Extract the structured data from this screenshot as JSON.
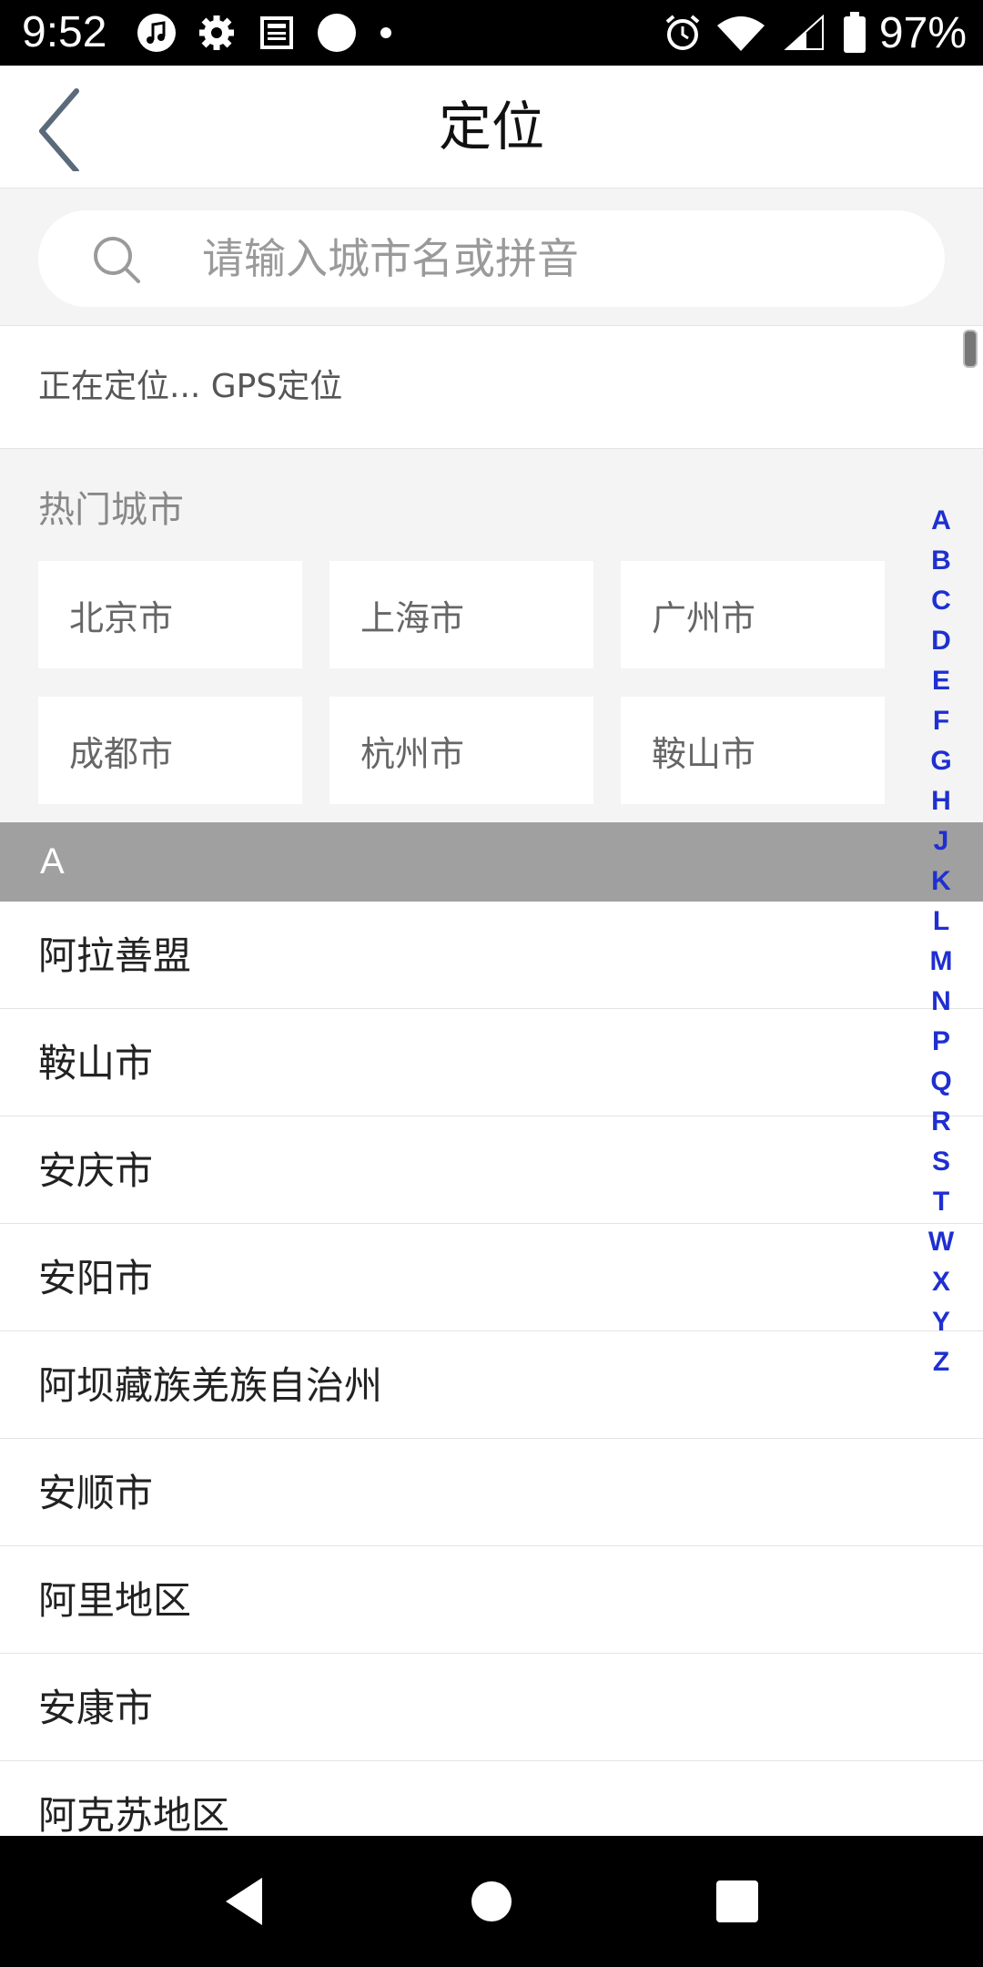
{
  "status_bar": {
    "time": "9:52",
    "battery": "97%",
    "left_icons": [
      "music-note-icon",
      "gear-icon",
      "news-icon",
      "circle-icon",
      "dot-icon"
    ],
    "right_icons": [
      "alarm-icon",
      "wifi-icon",
      "signal-icon",
      "battery-icon"
    ]
  },
  "header": {
    "title": "定位",
    "back_icon": "chevron-left-icon"
  },
  "search": {
    "placeholder": "请输入城市名或拼音",
    "icon": "search-icon"
  },
  "locating": {
    "text": "正在定位... GPS定位"
  },
  "hot_cities": {
    "title": "热门城市",
    "cities": [
      "北京市",
      "上海市",
      "广州市",
      "成都市",
      "杭州市",
      "鞍山市"
    ]
  },
  "section": {
    "letter": "A"
  },
  "city_list": [
    "阿拉善盟",
    "鞍山市",
    "安庆市",
    "安阳市",
    "阿坝藏族羌族自治州",
    "安顺市",
    "阿里地区",
    "安康市",
    "阿克苏地区"
  ],
  "alphabet_index": [
    "A",
    "B",
    "C",
    "D",
    "E",
    "F",
    "G",
    "H",
    "J",
    "K",
    "L",
    "M",
    "N",
    "P",
    "Q",
    "R",
    "S",
    "T",
    "W",
    "X",
    "Y",
    "Z"
  ],
  "nav_bar": {
    "icons": [
      "back-triangle-icon",
      "home-circle-icon",
      "recents-square-icon"
    ]
  },
  "colors": {
    "index_letter": "#1f2fd1",
    "section_header_bg": "#a0a0a0",
    "page_bg": "#f4f4f4"
  }
}
